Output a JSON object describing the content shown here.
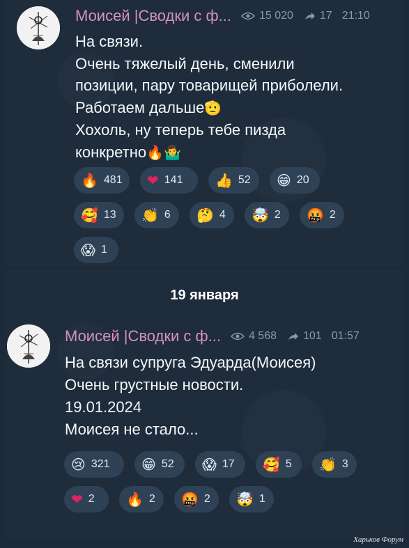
{
  "messages": [
    {
      "channel": "Моисей |Сводки с ф...",
      "views": "15 020",
      "forwards": "17",
      "time": "21:10",
      "lines": [
        "На связи.",
        "Очень тяжелый день, сменили",
        "позиции, пару товарищей приболели.",
        "Работаем дальше",
        "Хохоль, ну теперь тебе пизда",
        "конкретно"
      ],
      "inline_emojis": [
        "🫡",
        "🔥",
        "🤷‍♂️"
      ],
      "reactions": [
        {
          "icon": "fire-emoji",
          "glyph": "🔥",
          "count": "481"
        },
        {
          "icon": "heart-emoji",
          "glyph": "❤",
          "count": "141"
        },
        {
          "icon": "thumbs-up-emoji",
          "glyph": "👍",
          "count": "52"
        },
        {
          "icon": "grinning-emoji",
          "glyph": "😁",
          "count": "20"
        },
        {
          "icon": "hearts-face-emoji",
          "glyph": "🥰",
          "count": "13"
        },
        {
          "icon": "clapping-emoji",
          "glyph": "👏",
          "count": "6"
        },
        {
          "icon": "thinking-emoji",
          "glyph": "🤔",
          "count": "4"
        },
        {
          "icon": "mind-blown-emoji",
          "glyph": "🤯",
          "count": "2"
        },
        {
          "icon": "cursing-emoji",
          "glyph": "🤬",
          "count": "2"
        },
        {
          "icon": "screaming-emoji",
          "glyph": "😱",
          "count": "1"
        }
      ]
    },
    {
      "channel": "Моисей |Сводки с ф...",
      "views": "4 568",
      "forwards": "101",
      "time": "01:57",
      "lines": [
        "На связи супруга Эдуарда(Моисея)",
        "Очень грустные новости.",
        "19.01.2024",
        "Моисея не стало..."
      ],
      "reactions": [
        {
          "icon": "crying-emoji",
          "glyph": "😢",
          "count": "321"
        },
        {
          "icon": "grinning-emoji",
          "glyph": "😁",
          "count": "52"
        },
        {
          "icon": "screaming-emoji",
          "glyph": "😱",
          "count": "17"
        },
        {
          "icon": "hearts-face-emoji",
          "glyph": "🥰",
          "count": "5"
        },
        {
          "icon": "clapping-emoji",
          "glyph": "👏",
          "count": "3"
        },
        {
          "icon": "heart-emoji",
          "glyph": "❤",
          "count": "2"
        },
        {
          "icon": "fire-emoji",
          "glyph": "🔥",
          "count": "2"
        },
        {
          "icon": "cursing-emoji",
          "glyph": "🤬",
          "count": "2"
        },
        {
          "icon": "mind-blown-emoji",
          "glyph": "🤯",
          "count": "1"
        }
      ]
    }
  ],
  "date_separator": "19 января",
  "watermark": "Харьков Форум",
  "colors": {
    "background": "#1c2a3a",
    "channel_name": "#d98fc2",
    "meta": "#8a99aa",
    "reaction_bg": "#2f4255",
    "heart": "#e0245e"
  }
}
